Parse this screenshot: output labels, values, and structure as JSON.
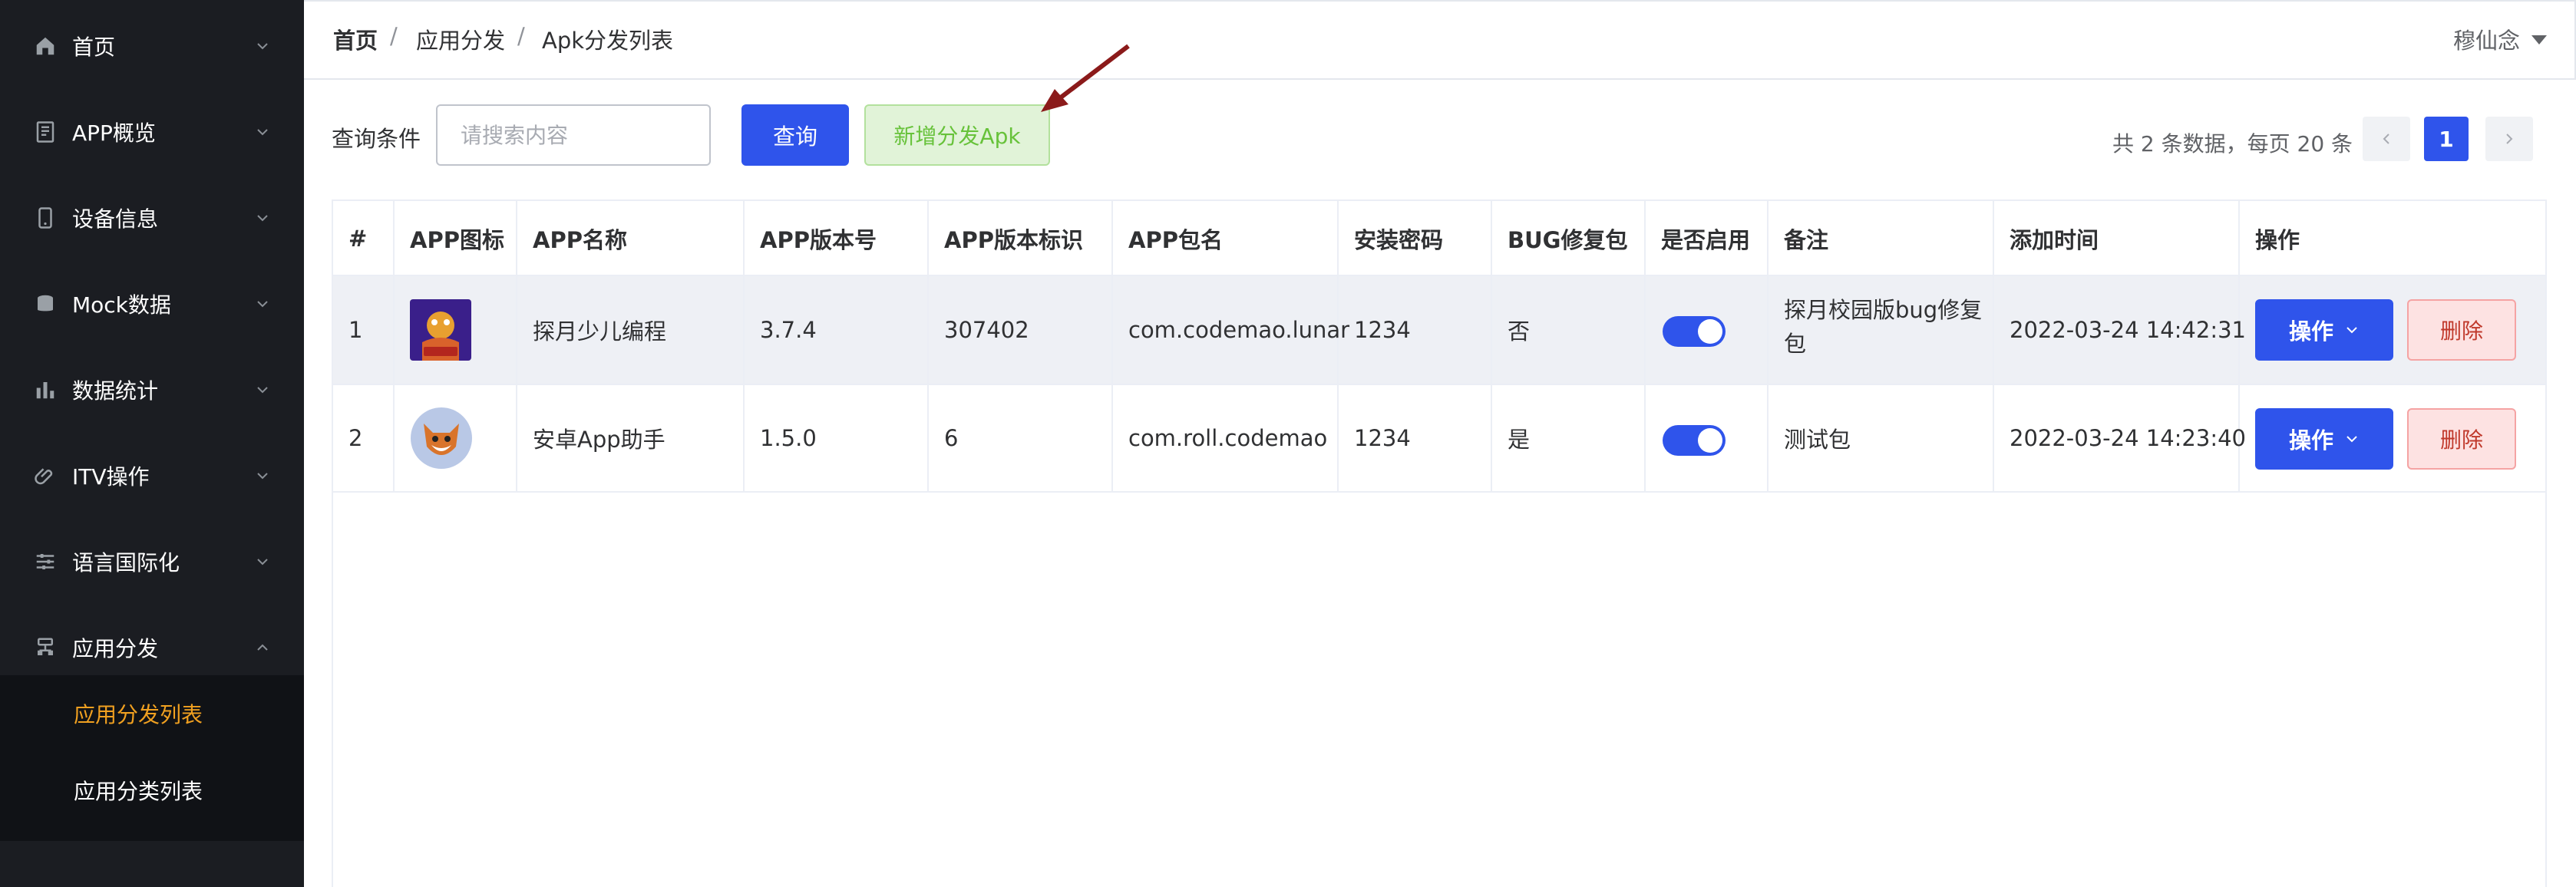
{
  "sidebar": {
    "items": [
      {
        "label": "首页",
        "icon": "home-icon"
      },
      {
        "label": "APP概览",
        "icon": "document-icon"
      },
      {
        "label": "设备信息",
        "icon": "phone-icon"
      },
      {
        "label": "Mock数据",
        "icon": "database-icon"
      },
      {
        "label": "数据统计",
        "icon": "bar-chart-icon"
      },
      {
        "label": "ITV操作",
        "icon": "paperclip-icon"
      },
      {
        "label": "语言国际化",
        "icon": "sliders-icon"
      },
      {
        "label": "应用分发",
        "icon": "app-icon"
      }
    ],
    "sub_items": [
      {
        "label": "应用分发列表",
        "active": true
      },
      {
        "label": "应用分类列表",
        "active": false
      }
    ],
    "active_color": "#f0a020"
  },
  "header": {
    "breadcrumb": [
      "首页",
      "应用分发",
      "Apk分发列表"
    ],
    "separator": "/",
    "user_name": "穆仙念"
  },
  "toolbar": {
    "query_label": "查询条件",
    "search_placeholder": "请搜索内容",
    "search_value": "",
    "query_button": "查询",
    "add_button": "新增分发Apk"
  },
  "pagination": {
    "info": "共 2 条数据，每页 20 条",
    "current_page": "1"
  },
  "table": {
    "columns": [
      "#",
      "APP图标",
      "APP名称",
      "APP版本号",
      "APP版本标识",
      "APP包名",
      "安装密码",
      "BUG修复包",
      "是否启用",
      "备注",
      "添加时间",
      "操作"
    ],
    "rows": [
      {
        "index": "1",
        "icon": "app-icon-lunar",
        "name": "探月少儿编程",
        "version": "3.7.4",
        "version_code": "307402",
        "package": "com.codemao.lunar",
        "password": "1234",
        "bug_fix": "否",
        "enabled": true,
        "remark": "探月校园版bug修复包",
        "added_time": "2022-03-24 14:42:31",
        "op_label": "操作",
        "delete_label": "删除"
      },
      {
        "index": "2",
        "icon": "app-icon-fox",
        "name": "安卓App助手",
        "version": "1.5.0",
        "version_code": "6",
        "package": "com.roll.codemao",
        "password": "1234",
        "bug_fix": "是",
        "enabled": true,
        "remark": "测试包",
        "added_time": "2022-03-24 14:23:40",
        "op_label": "操作",
        "delete_label": "删除"
      }
    ]
  },
  "colors": {
    "primary": "#2f54eb",
    "sidebar_bg": "#1b1d22",
    "success_bg": "#e1f3d8",
    "danger_bg": "#fde2e2",
    "annotation_arrow": "#8b1a1a"
  }
}
